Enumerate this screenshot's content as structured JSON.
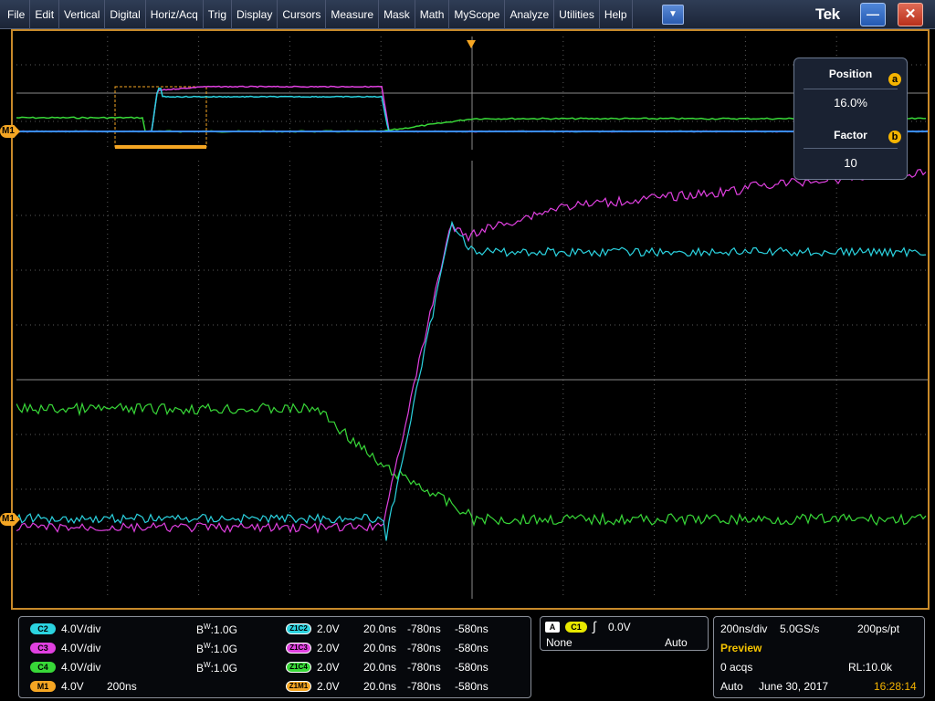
{
  "menu": {
    "items": [
      "File",
      "Edit",
      "Vertical",
      "Digital",
      "Horiz/Acq",
      "Trig",
      "Display",
      "Cursors",
      "Measure",
      "Mask",
      "Math",
      "MyScope",
      "Analyze",
      "Utilities",
      "Help"
    ],
    "dropdown_icon": "chevron-down-icon",
    "logo": "Tek",
    "minimize_icon": "minimize-icon",
    "close_icon": "close-icon"
  },
  "colors": {
    "c2": "#2bd3e0",
    "c3": "#e040e0",
    "c4": "#38d838",
    "m1": "#f5a623",
    "frame": "#c88a2a",
    "grid": "#7a7a7a"
  },
  "markers": {
    "trigger_icon": "trigger-position-icon",
    "m1_upper": "M1",
    "m1_lower": "M1"
  },
  "zoom_panel": {
    "position_label": "Position",
    "position_knob": "a",
    "position_value": "16.0%",
    "factor_label": "Factor",
    "factor_knob": "b",
    "factor_value": "10"
  },
  "channels": [
    {
      "badge": "C2",
      "scale": "4.0V/div",
      "bw_label": "W",
      "bw_prefix": "B",
      "bw_value": ":1.0G",
      "zoom_badge": "Z1C2",
      "zoom_scale": "2.0V",
      "zoom_time": "20.0ns",
      "zoom_pos1": "-780ns",
      "zoom_pos2": "-580ns"
    },
    {
      "badge": "C3",
      "scale": "4.0V/div",
      "bw_label": "W",
      "bw_prefix": "B",
      "bw_value": ":1.0G",
      "zoom_badge": "Z1C3",
      "zoom_scale": "2.0V",
      "zoom_time": "20.0ns",
      "zoom_pos1": "-780ns",
      "zoom_pos2": "-580ns"
    },
    {
      "badge": "C4",
      "scale": "4.0V/div",
      "bw_label": "W",
      "bw_prefix": "B",
      "bw_value": ":1.0G",
      "zoom_badge": "Z1C4",
      "zoom_scale": "2.0V",
      "zoom_time": "20.0ns",
      "zoom_pos1": "-780ns",
      "zoom_pos2": "-580ns"
    }
  ],
  "math": {
    "badge": "M1",
    "scale": "4.0V",
    "time": "200ns",
    "zoom_badge": "Z1M1",
    "zoom_scale": "2.0V",
    "zoom_time": "20.0ns",
    "zoom_pos1": "-780ns",
    "zoom_pos2": "-580ns"
  },
  "trigger": {
    "mode_badge": "A",
    "source_badge": "C1",
    "slope_icon": "rising-edge-icon",
    "level": "0.0V",
    "coupling": "None",
    "sweep": "Auto"
  },
  "acquisition": {
    "timebase": "200ns/div",
    "sample_rate": "5.0GS/s",
    "resolution": "200ps/pt",
    "status": "Preview",
    "acqs": "0 acqs",
    "record_length": "RL:10.0k",
    "mode": "Auto",
    "date": "June 30, 2017",
    "time": "16:28:14"
  }
}
